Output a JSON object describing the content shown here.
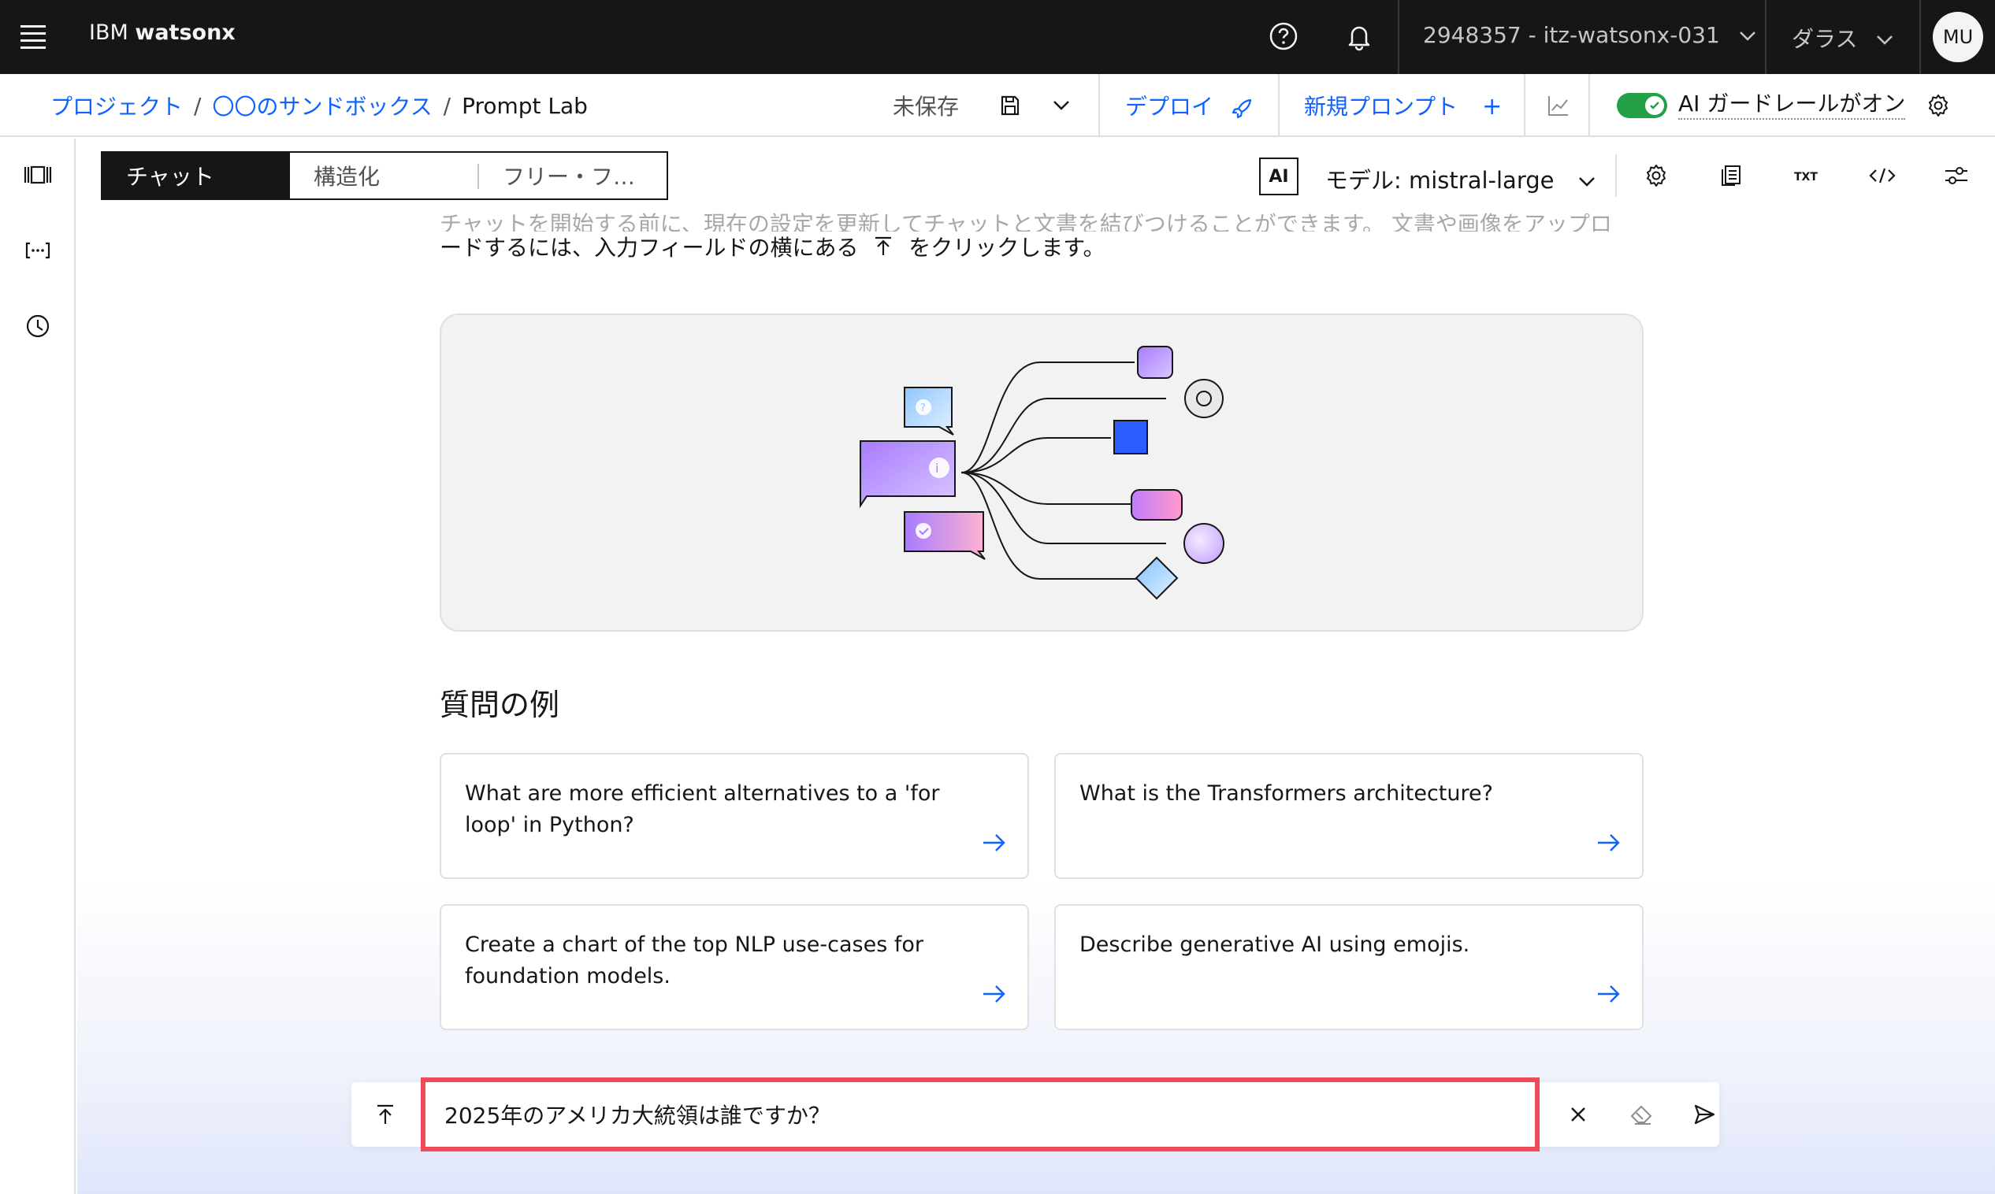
{
  "header": {
    "brand_prefix": "IBM",
    "brand_name": "watsonx",
    "account": "2948357 - itz-watsonx-031",
    "region": "ダラス",
    "avatar_initials": "MU"
  },
  "breadcrumb": {
    "items": [
      "プロジェクト",
      "〇〇のサンドボックス"
    ],
    "current": "Prompt Lab"
  },
  "actions": {
    "save_status": "未保存",
    "deploy_label": "デプロイ",
    "new_prompt_label": "新規プロンプト",
    "guardrail_label": "AI ガードレールがオン",
    "guardrail_on": true
  },
  "mode_tabs": [
    "チャット",
    "構造化",
    "フリー・フ…"
  ],
  "model": {
    "badge": "AI",
    "label": "モデル: mistral-large"
  },
  "intro": {
    "line1": "チャットを開始する前に、現在の設定を更新してチャットと文書を結びつけることができます。 文書や画像をアップロ",
    "line2_before": "ードするには、入力フィールドの横にある",
    "line2_after": "をクリックします。"
  },
  "examples": {
    "title": "質問の例",
    "items": [
      "What are more efficient alternatives to a 'for loop' in Python?",
      "What is the Transformers architecture?",
      "Create a chart of the top NLP use-cases for foundation models.",
      "Describe generative AI using emojis."
    ]
  },
  "chat_input": {
    "value": "2025年のアメリカ大統領は誰ですか？"
  },
  "colors": {
    "accent": "#0f62fe",
    "highlight_border": "#ee4b5a",
    "toggle_on": "#24a148",
    "header_bg": "#161616"
  }
}
